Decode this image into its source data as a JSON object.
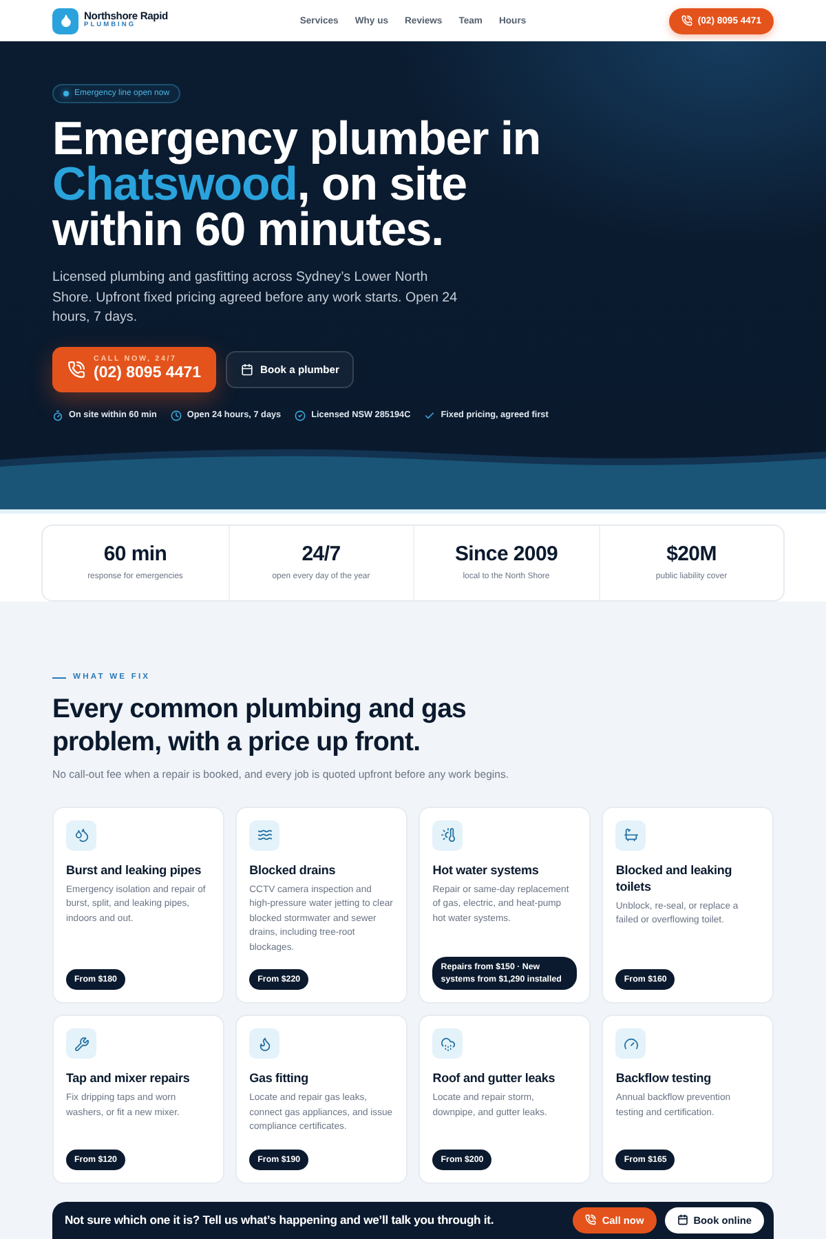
{
  "header": {
    "brand_name": "Northshore Rapid",
    "brand_tagline": "PLUMBING",
    "nav": [
      "Services",
      "Why us",
      "Reviews",
      "Team",
      "Hours"
    ],
    "phone_button": "(02) 8095 4471"
  },
  "hero": {
    "badge": "Emergency line open now",
    "heading": {
      "before": "Emergency plumber in ",
      "highlight": "Chatswood",
      "after": ", on site within 60 minutes."
    },
    "intro": "Licensed plumbing and gasfitting across Sydney’s Lower North Shore. Upfront fixed pricing agreed before any work starts. Open 24 hours, 7 days.",
    "call_button": {
      "caption": "CALL NOW, 24/7",
      "number": "(02) 8095 4471"
    },
    "book_button": "Book a plumber",
    "features": [
      "On site within 60 min",
      "Open 24 hours, 7 days",
      "Licensed NSW 285194C",
      "Fixed pricing, agreed first"
    ]
  },
  "stats": [
    {
      "value": "60 min",
      "label": "response for emergencies"
    },
    {
      "value": "24/7",
      "label": "open every day of the year"
    },
    {
      "value": "Since 2009",
      "label": "local to the North Shore"
    },
    {
      "value": "$20M",
      "label": "public liability cover"
    }
  ],
  "services": {
    "eyebrow": "WHAT WE FIX",
    "heading": "Every common plumbing and gas problem, with a price up front.",
    "intro": "No call-out fee when a repair is booked, and every job is quoted upfront before any work begins.",
    "cards": [
      {
        "title": "Burst and leaking pipes",
        "description": "Emergency isolation and repair of burst, split, and leaking pipes, indoors and out.",
        "price": "From $180"
      },
      {
        "title": "Blocked drains",
        "description": "CCTV camera inspection and high-pressure water jetting to clear blocked stormwater and sewer drains, including tree-root blockages.",
        "price": "From $220"
      },
      {
        "title": "Hot water systems",
        "description": "Repair or same-day replacement of gas, electric, and heat-pump hot water systems.",
        "price": "Repairs from $150 · New systems from $1,290 installed"
      },
      {
        "title": "Blocked and leaking toilets",
        "description": "Unblock, re-seal, or replace a failed or overflowing toilet.",
        "price": "From $160"
      },
      {
        "title": "Tap and mixer repairs",
        "description": "Fix dripping taps and worn washers, or fit a new mixer.",
        "price": "From $120"
      },
      {
        "title": "Gas fitting",
        "description": "Locate and repair gas leaks, connect gas appliances, and issue compliance certificates.",
        "price": "From $190"
      },
      {
        "title": "Roof and gutter leaks",
        "description": "Locate and repair storm, downpipe, and gutter leaks.",
        "price": "From $200"
      },
      {
        "title": "Backflow testing",
        "description": "Annual backflow prevention testing and certification.",
        "price": "From $165"
      }
    ]
  },
  "cta": {
    "text": "Not sure which one it is? Tell us what’s happening and we’ll talk you through it.",
    "buttons": [
      {
        "label": "Call now",
        "kind": "primary"
      },
      {
        "label": "Book online",
        "kind": "secondary"
      }
    ]
  }
}
